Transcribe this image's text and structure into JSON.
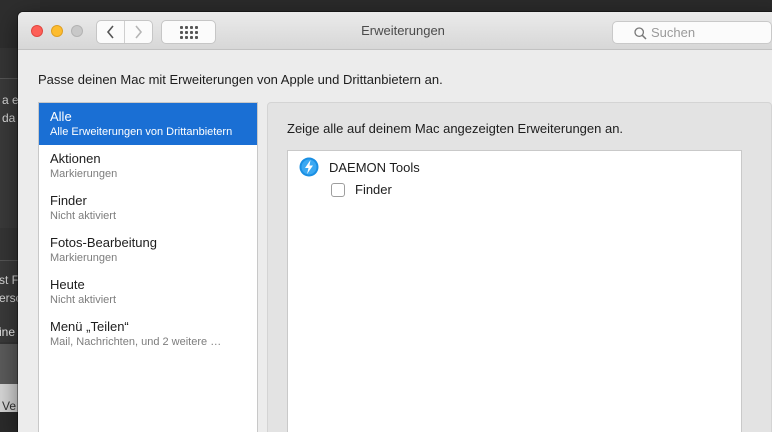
{
  "background_window": {
    "lines": [
      {
        "text": "a e"
      },
      {
        "text": "da"
      },
      {
        "text": "st F"
      },
      {
        "text": "ersc"
      },
      {
        "text": "ine"
      },
      {
        "text": "Ve"
      }
    ]
  },
  "window": {
    "title": "Erweiterungen",
    "nav_back": "‹",
    "nav_forward": "›",
    "search": {
      "placeholder": "Suchen",
      "value": ""
    }
  },
  "description": "Passe deinen Mac mit Erweiterungen von Apple und Drittanbietern an.",
  "sidebar": {
    "items": [
      {
        "label": "Alle",
        "sub": "Alle Erweiterungen von Drittanbietern",
        "selected": true
      },
      {
        "label": "Aktionen",
        "sub": "Markierungen"
      },
      {
        "label": "Finder",
        "sub": "Nicht aktiviert"
      },
      {
        "label": "Fotos-Bearbeitung",
        "sub": "Markierungen"
      },
      {
        "label": "Heute",
        "sub": "Nicht aktiviert"
      },
      {
        "label": "Menü „Teilen“",
        "sub": "Mail, Nachrichten, und 2 weitere …"
      }
    ]
  },
  "panel": {
    "heading": "Zeige alle auf deinem Mac angezeigten Erweiterungen an.",
    "apps": [
      {
        "name": "DAEMON Tools",
        "icon": "daemon-tools-icon",
        "extensions": [
          {
            "label": "Finder",
            "checked": false
          }
        ]
      }
    ]
  },
  "colors": {
    "selection": "#1a6fd4",
    "close": "#fd5f57",
    "minimize": "#fdbc2e",
    "zoom_inactive": "#c8c8c8"
  }
}
